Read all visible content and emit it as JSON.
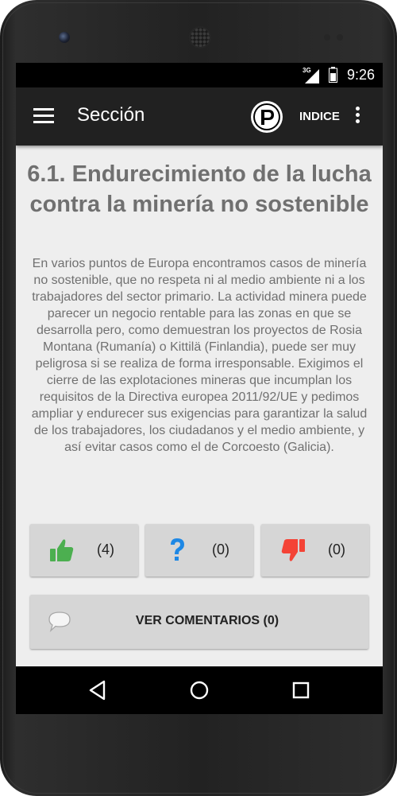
{
  "status_bar": {
    "network": "3G",
    "time": "9:26"
  },
  "app_bar": {
    "title": "Sección",
    "index_label": "INDICE"
  },
  "section": {
    "title": "6.1. Endurecimiento de la lucha contra la minería no sostenible",
    "body": "En varios puntos de Europa encontramos casos de minería no sostenible, que no respeta ni al medio ambiente ni a los trabajadores del sector primario. La actividad minera puede parecer un negocio rentable para las zonas en que se desarrolla pero, como demuestran los proyectos de Rosia Montana (Rumanía) o Kittilä (Finlandia), puede ser muy peligrosa si se realiza de forma irresponsable. Exigimos el cierre de las explotaciones mineras que incumplan los requisitos de la Directiva europea 2011/92/UE y pedimos ampliar y endurecer sus exigencias para garantizar la salud de los trabajadores, los ciudadanos y el medio ambiente, y así evitar casos como el de Corcoesto (Galicia)."
  },
  "votes": {
    "up": {
      "count": "(4)",
      "icon": "thumbs-up-icon",
      "color": "#4caf50"
    },
    "question": {
      "count": "(0)",
      "icon": "question-icon",
      "color": "#1e88e5"
    },
    "down": {
      "count": "(0)",
      "icon": "thumbs-down-icon",
      "color": "#f44336"
    }
  },
  "comments": {
    "label": "VER COMENTARIOS  (0)",
    "icon": "comment-bubble-icon"
  }
}
